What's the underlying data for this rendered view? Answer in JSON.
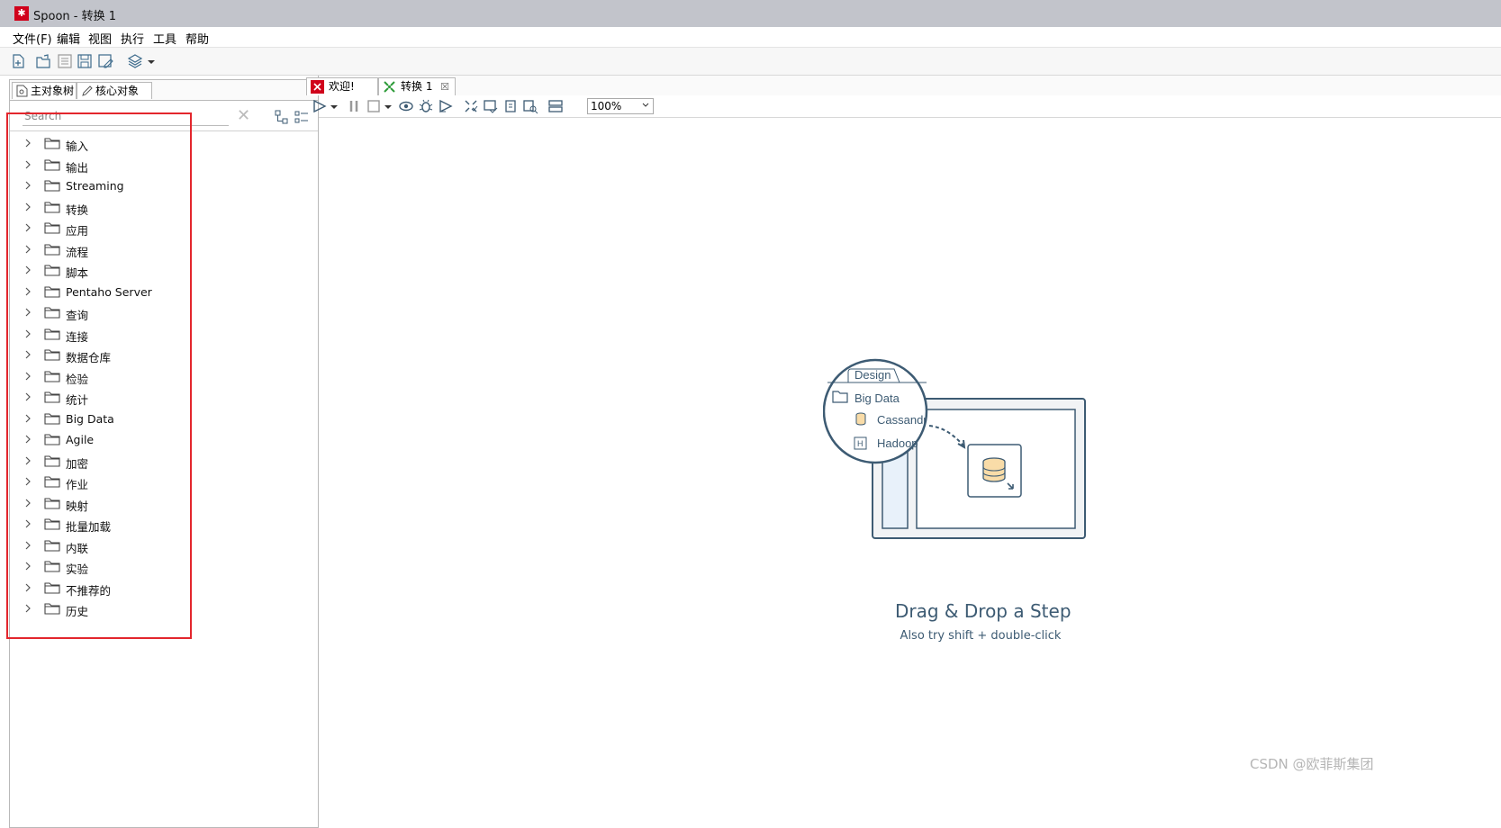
{
  "window": {
    "title": "Spoon - 转换 1",
    "logo_char": "✱"
  },
  "menu": [
    "文件(F)",
    "编辑",
    "视图",
    "执行",
    "工具",
    "帮助"
  ],
  "left_tabs": [
    {
      "label": "主对象树"
    },
    {
      "label": "核心对象"
    }
  ],
  "search": {
    "placeholder": "Search",
    "value": ""
  },
  "tree_items": [
    "输入",
    "输出",
    "Streaming",
    "转换",
    "应用",
    "流程",
    "脚本",
    "Pentaho Server",
    "查询",
    "连接",
    "数据仓库",
    "检验",
    "统计",
    "Big Data",
    "Agile",
    "加密",
    "作业",
    "映射",
    "批量加载",
    "内联",
    "实验",
    "不推荐的",
    "历史"
  ],
  "right_tabs": [
    {
      "label": "欢迎!"
    },
    {
      "label": "转换 1"
    }
  ],
  "zoom": {
    "value": "100%"
  },
  "illustration": {
    "design_tab": "Design",
    "folder": "Big Data",
    "item1": "Cassandr",
    "item2": "Hadoop",
    "hadoop_letter": "H"
  },
  "drag_drop": {
    "title": "Drag & Drop a Step",
    "subtitle": "Also try shift + double-click"
  },
  "watermark": "CSDN @欧菲斯集团",
  "colors": {
    "accent": "#3d5b73",
    "highlight": "#e3262d",
    "logo": "#d0021b",
    "titlebar": "#c2c4cb"
  }
}
